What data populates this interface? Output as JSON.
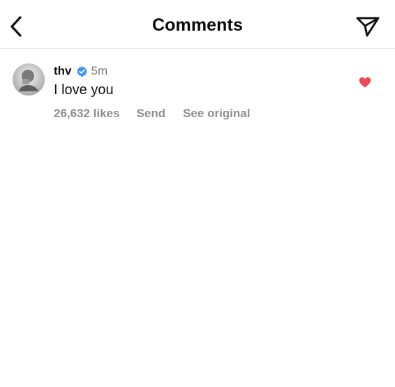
{
  "header": {
    "title": "Comments",
    "back_icon": "chevron-left-icon",
    "send_icon": "paper-plane-icon"
  },
  "comment": {
    "username": "thv",
    "verified": true,
    "verified_color": "#3897f0",
    "time": "5m",
    "text": "I love you",
    "likes": "26,632 likes",
    "send_label": "Send",
    "see_original_label": "See original",
    "liked": true,
    "heart_color": "#ed4956"
  }
}
